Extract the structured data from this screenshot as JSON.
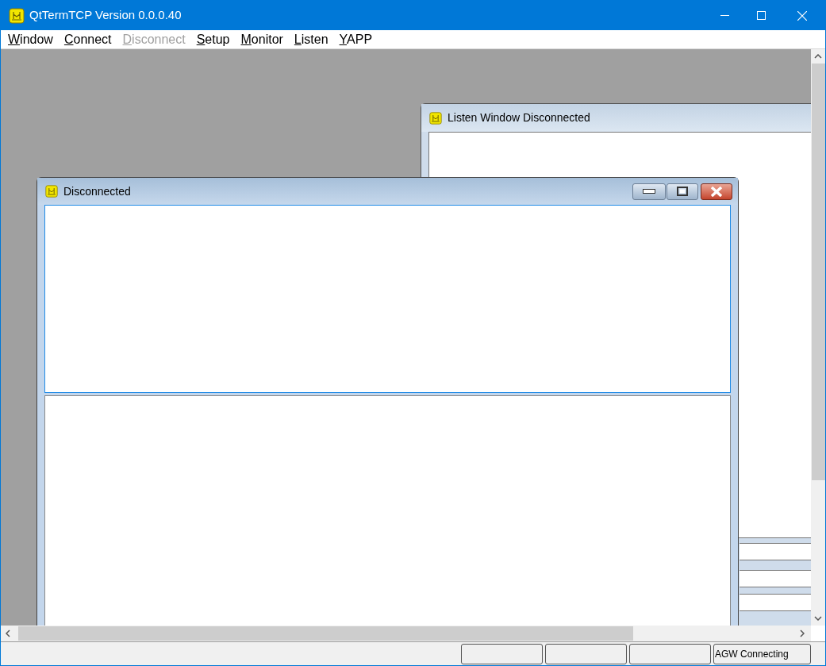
{
  "window": {
    "title": "QtTermTCP Version 0.0.0.40"
  },
  "menu": [
    {
      "mnemonic": "W",
      "rest": "indow",
      "disabled": false
    },
    {
      "mnemonic": "C",
      "rest": "onnect",
      "disabled": false
    },
    {
      "mnemonic": "D",
      "rest": "isconnect",
      "disabled": true
    },
    {
      "mnemonic": "S",
      "rest": "etup",
      "disabled": false
    },
    {
      "mnemonic": "M",
      "rest": "onitor",
      "disabled": false
    },
    {
      "mnemonic": "L",
      "rest": "isten",
      "disabled": false
    },
    {
      "mnemonic": "Y",
      "rest": "APP",
      "disabled": false
    }
  ],
  "listen_window": {
    "title": "Listen Window Disconnected"
  },
  "session_window": {
    "title": "Disconnected"
  },
  "status_bar": {
    "status": "AGW Connecting"
  }
}
